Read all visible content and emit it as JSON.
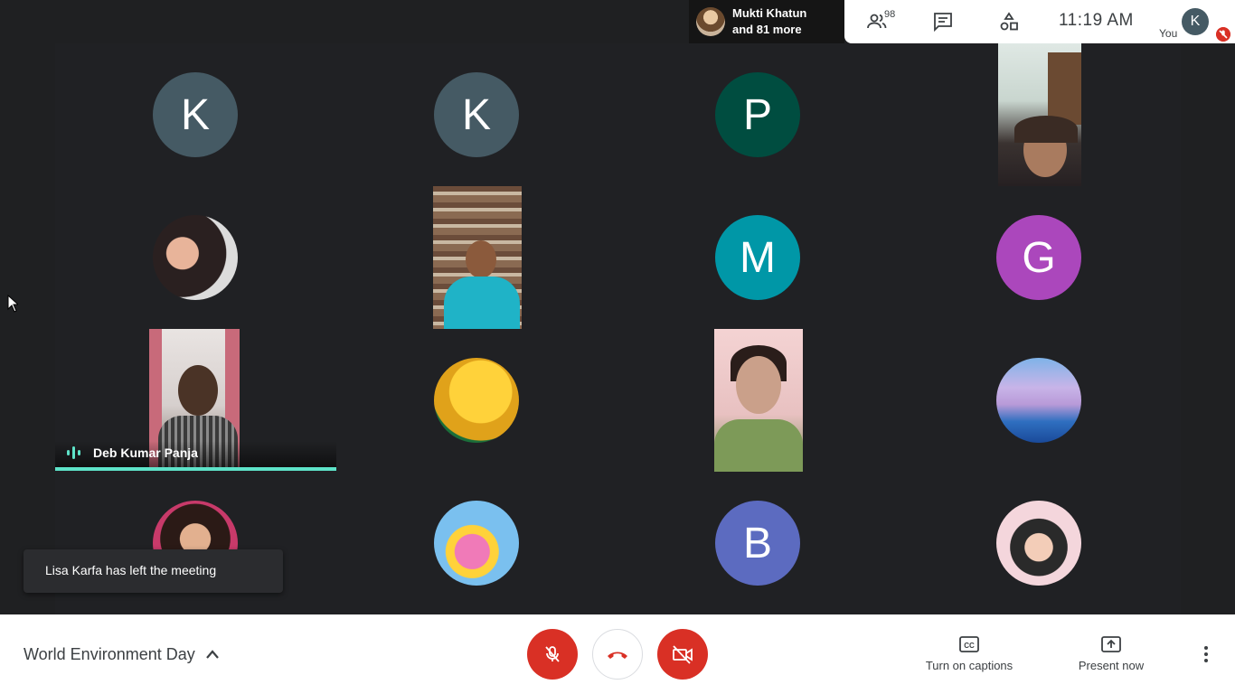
{
  "top_bar": {
    "presenting_name": "Mukti Khatun",
    "presenting_more": "and 81 more",
    "participants_count": "98",
    "time": "11:19  AM",
    "user_initial": "K",
    "user_label": "You",
    "icons": [
      "people-icon",
      "chat-icon",
      "activities-icon"
    ]
  },
  "tiles": [
    {
      "type": "avatar",
      "initial": "K",
      "color": "#455a64"
    },
    {
      "type": "avatar",
      "initial": "K",
      "color": "#455a64"
    },
    {
      "type": "avatar",
      "initial": "P",
      "color": "#004d40"
    },
    {
      "type": "video"
    },
    {
      "type": "photo-avatar"
    },
    {
      "type": "video"
    },
    {
      "type": "avatar",
      "initial": "M",
      "color": "#0097a7"
    },
    {
      "type": "avatar",
      "initial": "G",
      "color": "#ab47bc"
    },
    {
      "type": "video"
    },
    {
      "type": "photo-avatar"
    },
    {
      "type": "video"
    },
    {
      "type": "photo-avatar"
    },
    {
      "type": "photo-avatar"
    },
    {
      "type": "photo-avatar"
    },
    {
      "type": "avatar",
      "initial": "B",
      "color": "#5c6bc0"
    },
    {
      "type": "photo-avatar"
    }
  ],
  "active_speaker": {
    "name": "Deb Kumar Panja",
    "accent": "#5ee3c9"
  },
  "toast": {
    "message": "Lisa Karfa has left the meeting"
  },
  "bottom_bar": {
    "meeting_title": "World Environment Day",
    "captions_label": "Turn on captions",
    "present_label": "Present now",
    "mic_state": "muted",
    "camera_state": "off",
    "accent_red": "#d93025"
  }
}
